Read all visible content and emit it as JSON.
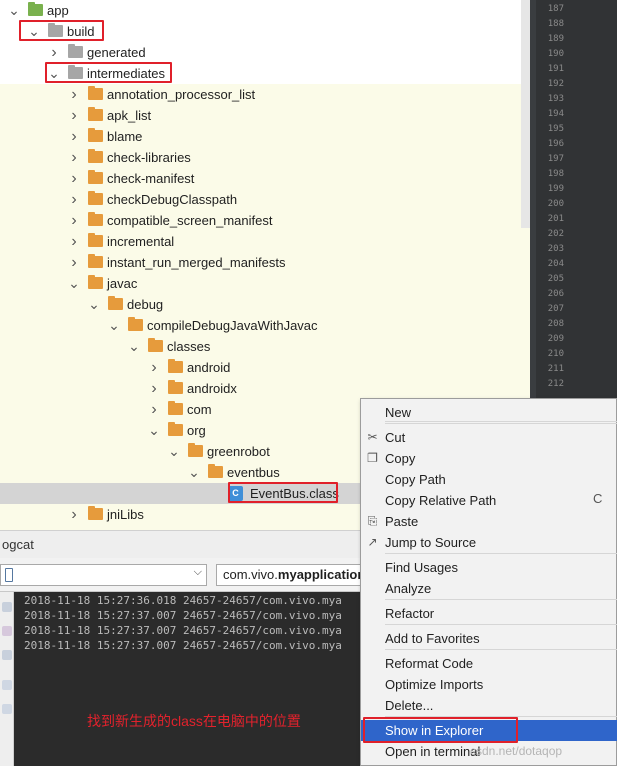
{
  "tree": {
    "rows": [
      {
        "label": "app",
        "depth": 0,
        "icon": "app-folder",
        "expanded": true
      },
      {
        "label": "build",
        "depth": 1,
        "icon": "gray-folder",
        "expanded": true
      },
      {
        "label": "generated",
        "depth": 2,
        "icon": "gray-folder",
        "expanded": false
      },
      {
        "label": "intermediates",
        "depth": 2,
        "icon": "gray-folder",
        "expanded": true
      },
      {
        "label": "annotation_processor_list",
        "depth": 3,
        "icon": "orange-folder",
        "expanded": false
      },
      {
        "label": "apk_list",
        "depth": 3,
        "icon": "orange-folder",
        "expanded": false
      },
      {
        "label": "blame",
        "depth": 3,
        "icon": "orange-folder",
        "expanded": false
      },
      {
        "label": "check-libraries",
        "depth": 3,
        "icon": "orange-folder",
        "expanded": false
      },
      {
        "label": "check-manifest",
        "depth": 3,
        "icon": "orange-folder",
        "expanded": false
      },
      {
        "label": "checkDebugClasspath",
        "depth": 3,
        "icon": "orange-folder",
        "expanded": false
      },
      {
        "label": "compatible_screen_manifest",
        "depth": 3,
        "icon": "orange-folder",
        "expanded": false
      },
      {
        "label": "incremental",
        "depth": 3,
        "icon": "orange-folder",
        "expanded": false
      },
      {
        "label": "instant_run_merged_manifests",
        "depth": 3,
        "icon": "orange-folder",
        "expanded": false
      },
      {
        "label": "javac",
        "depth": 3,
        "icon": "orange-folder",
        "expanded": true
      },
      {
        "label": "debug",
        "depth": 4,
        "icon": "orange-folder",
        "expanded": true
      },
      {
        "label": "compileDebugJavaWithJavac",
        "depth": 5,
        "icon": "orange-folder",
        "expanded": true
      },
      {
        "label": "classes",
        "depth": 6,
        "icon": "orange-folder",
        "expanded": true
      },
      {
        "label": "android",
        "depth": 7,
        "icon": "orange-folder",
        "expanded": false
      },
      {
        "label": "androidx",
        "depth": 7,
        "icon": "orange-folder",
        "expanded": false
      },
      {
        "label": "com",
        "depth": 7,
        "icon": "orange-folder",
        "expanded": false
      },
      {
        "label": "org",
        "depth": 7,
        "icon": "orange-folder",
        "expanded": true
      },
      {
        "label": "greenrobot",
        "depth": 8,
        "icon": "orange-folder",
        "expanded": true
      },
      {
        "label": "eventbus",
        "depth": 9,
        "icon": "orange-folder",
        "expanded": true
      },
      {
        "label": "EventBus.class",
        "depth": 10,
        "icon": "class-file",
        "expanded": null
      },
      {
        "label": "jniLibs",
        "depth": 3,
        "icon": "orange-folder",
        "expanded": false
      }
    ]
  },
  "gutter": {
    "line_numbers": [
      "187",
      "188",
      "189",
      "190",
      "191",
      "192",
      "193",
      "194",
      "195",
      "196",
      "197",
      "198",
      "199",
      "200",
      "201",
      "202",
      "203",
      "204",
      "205",
      "206",
      "207",
      "208",
      "209",
      "210",
      "211",
      "212"
    ]
  },
  "logcat": {
    "title": "ogcat",
    "package_filter_prefix": "com.vivo.",
    "package_filter_bold": "myapplication",
    "lines": [
      "2018-11-18 15:27:36.018 24657-24657/com.vivo.mya",
      "2018-11-18 15:27:37.007 24657-24657/com.vivo.mya",
      "2018-11-18 15:27:37.007 24657-24657/com.vivo.mya",
      "2018-11-18 15:27:37.007 24657-24657/com.vivo.mya"
    ],
    "annotation": "找到新生成的class在电脑中的位置"
  },
  "context_menu": {
    "items": [
      {
        "label": "New",
        "icon": ""
      },
      {
        "label": "Cut",
        "icon": "scissors-icon"
      },
      {
        "label": "Copy",
        "icon": "copy-icon"
      },
      {
        "label": "Copy Path",
        "icon": ""
      },
      {
        "label": "Copy Relative Path",
        "icon": ""
      },
      {
        "label": "Paste",
        "icon": "paste-icon"
      },
      {
        "label": "Jump to Source",
        "icon": "jump-icon"
      },
      {
        "label": "Find Usages",
        "icon": ""
      },
      {
        "label": "Analyze",
        "icon": ""
      },
      {
        "label": "Refactor",
        "icon": ""
      },
      {
        "label": "Add to Favorites",
        "icon": ""
      },
      {
        "label": "Reformat Code",
        "icon": ""
      },
      {
        "label": "Optimize Imports",
        "icon": ""
      },
      {
        "label": "Delete...",
        "icon": ""
      },
      {
        "label": "Show in Explorer",
        "icon": ""
      },
      {
        "label": "Open in terminal",
        "icon": ""
      }
    ],
    "shortcut_fragment": "C",
    "active_item": "Show in Explorer"
  },
  "watermark": "csdn.net/dotaqop",
  "colors": {
    "highlight_border": "#e0202a",
    "menu_selection": "#2f65ca",
    "folder_orange": "#e69b3c",
    "annotation_text": "#e2222c"
  }
}
